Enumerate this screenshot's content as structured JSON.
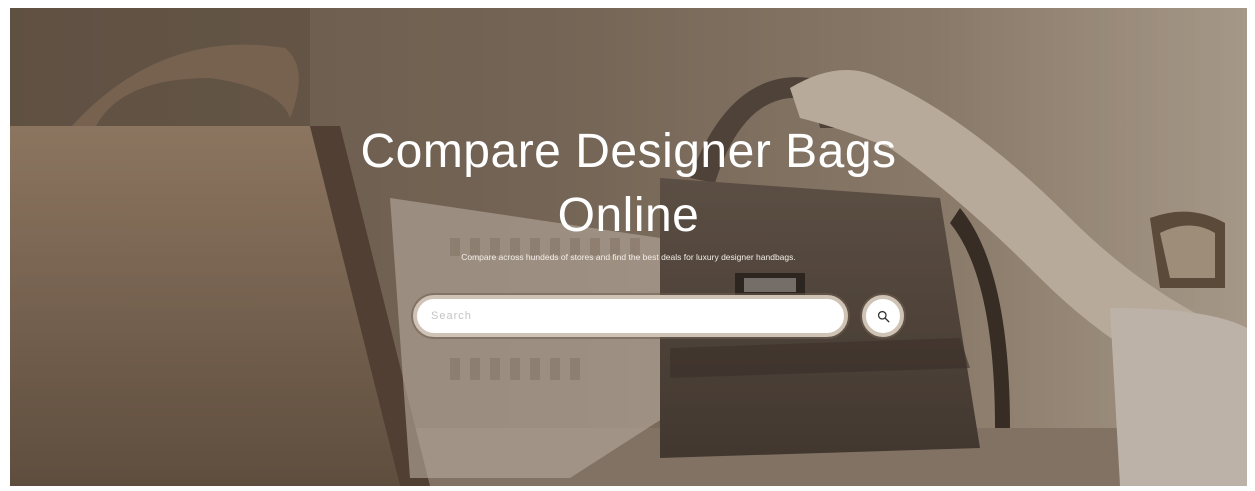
{
  "hero": {
    "title_line1": "Compare Designer Bags",
    "title_line2": "Online",
    "subtitle": "Compare across hundeds of stores and find the best deals for luxury designer handbags."
  },
  "search": {
    "placeholder": "Search",
    "value": "",
    "button_icon": "search-icon"
  },
  "colors": {
    "overlay_tint": "#6d5f51",
    "title_text": "#ffffff",
    "search_border": "#cfc3b5"
  }
}
